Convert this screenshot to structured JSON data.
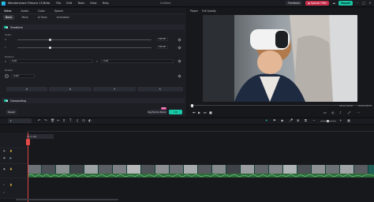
{
  "app": {
    "title": "Wondershare Filmora 13 Beta",
    "menus": [
      "File",
      "Edit",
      "Tools",
      "View",
      "Help"
    ],
    "center_title": "Untitled",
    "feedback": "Feedback",
    "promo": "◆ Special Offer",
    "export": "Export"
  },
  "panel": {
    "tabs": [
      "Video",
      "Audio",
      "Color",
      "Speed"
    ],
    "active_tab": "Video",
    "subtabs": [
      "Basic",
      "Mask",
      "AI Tools",
      "Animation"
    ],
    "active_subtab": "Basic",
    "transform": {
      "label": "Transform",
      "scale_label": "Scale",
      "x_label": "X",
      "y_label": "Y",
      "x_value": "100.00",
      "y_value": "100.00",
      "scale_percent": 100
    },
    "position": {
      "label": "Position",
      "x_label": "X",
      "x_value": "0.00",
      "y_label": "Y",
      "y_value": "0.00"
    },
    "rotate": {
      "label": "Rotate",
      "value": "0.00°"
    },
    "flip_icons": [
      "flip-horizontal-icon",
      "flip-vertical-icon",
      "rotate-left-icon",
      "rotate-right-icon"
    ],
    "compositing": {
      "label": "Compositing"
    },
    "buttons": {
      "reset": "Reset",
      "keyframe": "Keyframe Panel",
      "new_badge": "NEW",
      "ok": "OK"
    }
  },
  "player": {
    "tabs": [
      "Player",
      "Full Quality"
    ],
    "current_time": "00:00:00:00",
    "total_time": "00:00:08:25",
    "progress": 0.01
  },
  "timeline": {
    "toolbar_icons": [
      "undo-icon",
      "redo-icon",
      "delete-icon",
      "cut-icon",
      "crop-icon",
      "text-icon",
      "audio-icon",
      "speed-icon",
      "color-icon",
      "marker-icon",
      "keyframe-icon",
      "ai-icon",
      "snapshot-icon",
      "zoom-out-icon",
      "zoom-in-icon",
      "layout-icon"
    ],
    "track_label": "Composition clip",
    "colors": {
      "clip": "#1f5e57",
      "audio": "#2c6b3a",
      "playhead": "#e34a4a",
      "accent": "#19c7a6"
    }
  }
}
